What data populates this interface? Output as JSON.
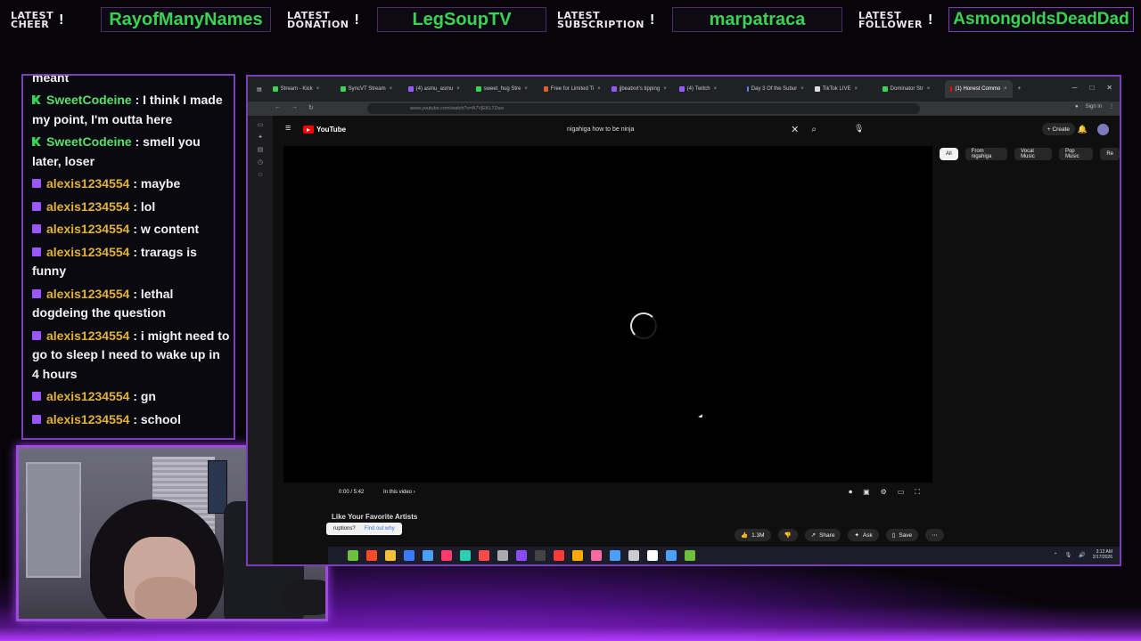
{
  "overlay": {
    "alerts": [
      {
        "label_line1": "LATEST",
        "label_line2": "CHEER",
        "name": "RayofManyNames"
      },
      {
        "label_line1": "LATEST",
        "label_line2": "DONATION",
        "name": "LegSoupTV"
      },
      {
        "label_line1": "LATEST",
        "label_line2": "SUBSCRIPTION",
        "name": "marpatraca"
      },
      {
        "label_line1": "LATEST",
        "label_line2": "FOLLOWER",
        "name": "AsmongoldsDeadDad"
      }
    ],
    "bang": "!",
    "colors": {
      "accent": "#a04be0",
      "name_green": "#39d353",
      "user_gold": "#e0b23a",
      "user_green": "#58e06a"
    }
  },
  "chat": {
    "messages": [
      {
        "platform": "kick",
        "user": "SweetCodeine",
        "text": ": that's what I meant"
      },
      {
        "platform": "kick",
        "user": "SweetCodeine",
        "text": ": I think I made my point, I'm outta here"
      },
      {
        "platform": "kick",
        "user": "SweetCodeine",
        "text": ": smell you later, loser"
      },
      {
        "platform": "twitch",
        "user": "alexis1234554",
        "text": ": maybe"
      },
      {
        "platform": "twitch",
        "user": "alexis1234554",
        "text": ": lol"
      },
      {
        "platform": "twitch",
        "user": "alexis1234554",
        "text": ": w content"
      },
      {
        "platform": "twitch",
        "user": "alexis1234554",
        "text": ": trarags is funny"
      },
      {
        "platform": "twitch",
        "user": "alexis1234554",
        "text": ": lethal dogdeing the question"
      },
      {
        "platform": "twitch",
        "user": "alexis1234554",
        "text": ": i might need to go to sleep I need to wake up in 4 hours"
      },
      {
        "platform": "twitch",
        "user": "alexis1234554",
        "text": ": gn"
      },
      {
        "platform": "twitch",
        "user": "alexis1234554",
        "text": ": school"
      }
    ]
  },
  "browser": {
    "tabs": [
      {
        "label": "Stream - Kick",
        "color": "#39d353"
      },
      {
        "label": "SyncVT Stream",
        "color": "#39d353"
      },
      {
        "label": "(4) asmu_asmu",
        "color": "#9a57ff"
      },
      {
        "label": "sweet_hug Stre",
        "color": "#39d353"
      },
      {
        "label": "Free for Limited Ti",
        "color": "#e0601f"
      },
      {
        "label": "jjbeatxvt's tipping",
        "color": "#9a57ff"
      },
      {
        "label": "(4) Twitch",
        "color": "#9a57ff"
      },
      {
        "label": "Day 3 Of the Subur",
        "color": "#4a8af4"
      },
      {
        "label": "TikTok LIVE",
        "color": "#dddddd"
      },
      {
        "label": "Dominator Str",
        "color": "#39d353"
      },
      {
        "label": "(1) Honest Commo",
        "color": "#ff0000"
      }
    ],
    "url": "www.youtube.com/watch?v=A7VjEKL7Zwo",
    "sign_in": "Sign in"
  },
  "youtube": {
    "logo_text": "YouTube",
    "search_query": "nigahiga how to be ninja",
    "create_label": "Create",
    "chips": [
      "All",
      "From nigahiga",
      "Vocal Music",
      "Pop Music",
      "Re"
    ],
    "time": "0:00 / 5:42",
    "chapter": "In this video",
    "below_title": "Like Your Favorite Artists",
    "tooltip_text": "ruptions?",
    "tooltip_link": "Find out why",
    "actions": {
      "likes": "1.3M",
      "share": "Share",
      "ask": "Ask",
      "save": "Save"
    }
  },
  "taskbar": {
    "icon_colors": [
      "#6fbf3a",
      "#ff4a2a",
      "#f0c03a",
      "#3a7aff",
      "#4aa0ff",
      "#ff3a6a",
      "#2ad0b0",
      "#ff4a4a",
      "#aaaaaa",
      "#8a4aff",
      "#444444",
      "#ff3a3a",
      "#ffaa00",
      "#ff6aa0",
      "#4aa0ff",
      "#cccccc",
      "#ffffff",
      "#4aa0ff",
      "#6fbf3a"
    ],
    "time": "3:12 AM",
    "date": "2/17/2026"
  }
}
